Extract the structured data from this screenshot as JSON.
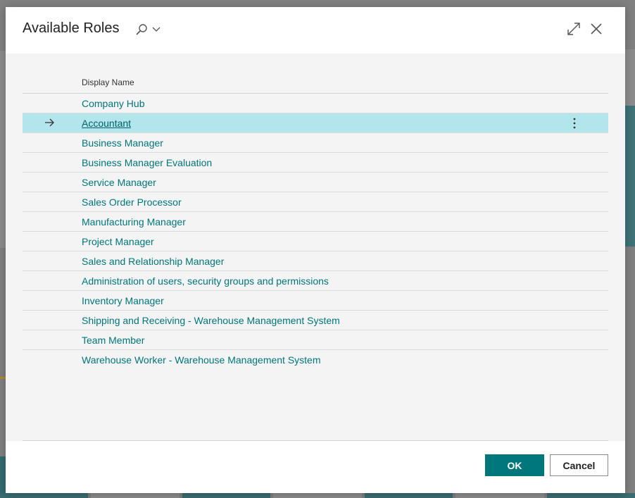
{
  "dialog": {
    "title": "Available Roles",
    "search_icon": "search-icon",
    "dropdown_icon": "chevron-down-icon",
    "expand_icon": "expand-icon",
    "close_icon": "close-icon"
  },
  "list": {
    "column_header": "Display Name",
    "selected_index": 1,
    "rows": [
      "Company Hub",
      "Accountant",
      "Business Manager",
      "Business Manager Evaluation",
      "Service Manager",
      "Sales Order Processor",
      "Manufacturing Manager",
      "Project Manager",
      "Sales and Relationship Manager",
      "Administration of users, security groups and permissions",
      "Inventory Manager",
      "Shipping and Receiving - Warehouse Management System",
      "Team Member",
      "Warehouse Worker - Warehouse Management System"
    ]
  },
  "footer": {
    "ok_label": "OK",
    "cancel_label": "Cancel"
  },
  "colors": {
    "accent": "#00787b",
    "selected_row": "#b2e6ec",
    "link": "#00767a"
  }
}
